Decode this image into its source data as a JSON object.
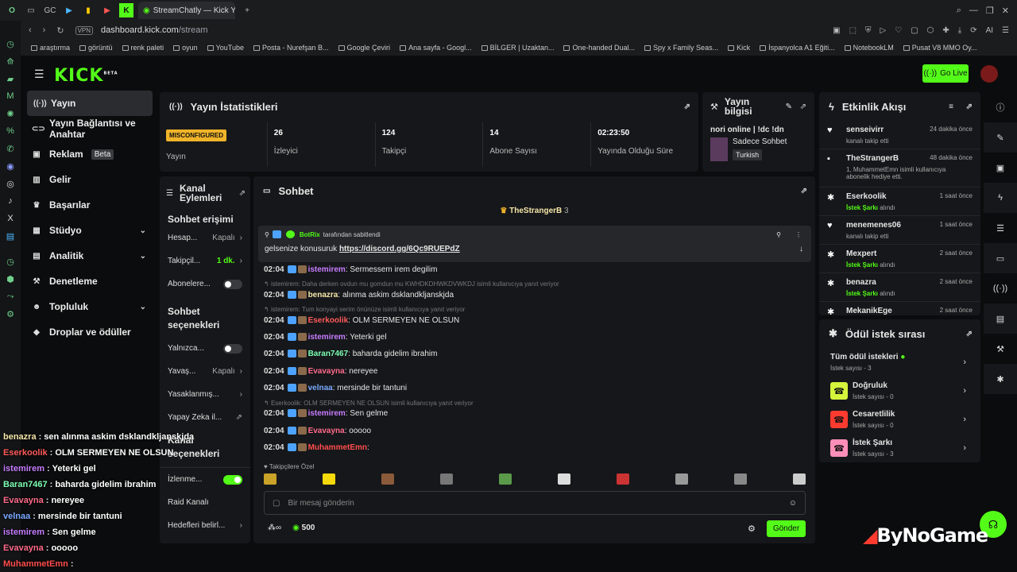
{
  "browser": {
    "tab_title": "StreamChatly — Kick Yayın",
    "url": "dashboard.kick.com/stream",
    "url_domain": "dashboard.kick.com",
    "url_path": "/stream",
    "vpn": "VPN",
    "ai": "AI",
    "bookmarks": [
      "araştırma",
      "görüntü",
      "renk paleti",
      "oyun",
      "YouTube",
      "Posta - Nurefşan B...",
      "Google Çeviri",
      "Ana sayfa - Googl...",
      "BİLGER | Uzaktan...",
      "One-handed Dual...",
      "Spy x Family Seas...",
      "Kick",
      "İspanyolca A1 Eğiti...",
      "NotebookLM",
      "Pusat V8 MMO Oy..."
    ]
  },
  "kick": {
    "logo": "KICK",
    "logo_sup": "BETA",
    "go_live": "Go Live"
  },
  "nav": {
    "items": [
      {
        "label": "Yayın",
        "icon": "((·))"
      },
      {
        "label": "Yayın Bağlantısı ve Anahtar",
        "icon": "⊂⊃"
      },
      {
        "label": "Reklam",
        "icon": "▣",
        "badge": "Beta"
      },
      {
        "label": "Gelir",
        "icon": "▥"
      },
      {
        "label": "Başarılar",
        "icon": "♛"
      },
      {
        "label": "Stüdyo",
        "icon": "▦",
        "chev": "⌄"
      },
      {
        "label": "Analitik",
        "icon": "▤",
        "chev": "⌄"
      },
      {
        "label": "Denetleme",
        "icon": "⚒"
      },
      {
        "label": "Topluluk",
        "icon": "☻",
        "chev": "⌄"
      },
      {
        "label": "Droplar ve ödüller",
        "icon": "◆"
      }
    ]
  },
  "stats": {
    "title": "Yayın İstatistikleri",
    "status_badge": "MISCONFIGURED",
    "status_label": "Yayın",
    "items": [
      {
        "value": "26",
        "label": "İzleyici"
      },
      {
        "value": "124",
        "label": "Takipçi"
      },
      {
        "value": "14",
        "label": "Abone Sayısı"
      },
      {
        "value": "02:23:50",
        "label": "Yayında Olduğu Süre"
      }
    ]
  },
  "info": {
    "title_line1": "Yayın",
    "title_line2": "bilgisi",
    "stream_title": "nori online | !dc !dn",
    "category": "Sadece Sohbet",
    "tag": "Turkish"
  },
  "actions": {
    "title_line1": "Kanal",
    "title_line2": "Eylemleri",
    "sec_chat": "Sohbet erişimi",
    "r1_label": "Hesap...",
    "r1_val": "Kapalı",
    "r2_label": "Takipçil...",
    "r2_val": "1 dk.",
    "r3_label": "Abonelere...",
    "sec_options_1": "Sohbet",
    "sec_options_2": "seçenekleri",
    "r4_label": "Yalnızca...",
    "r5_label": "Yavaş...",
    "r5_val": "Kapalı",
    "r6_label": "Yasaklanmış...",
    "r7_label": "Yapay Zeka il...",
    "sec_channel": "Kanal seçenekleri",
    "r8_label": "İzlenme...",
    "r9_label": "Raid Kanalı",
    "r10_label": "Hedefleri belirl..."
  },
  "chat": {
    "title": "Sohbet",
    "top_gifter": "TheStrangerB",
    "top_gifter_count": "3",
    "pinned_by": "BotRix",
    "pinned_by_suffix": "tarafından sabitlendi",
    "pinned_text": "gelsenize konusuruk",
    "pinned_link": "https://discord.gg/6Qc9RUEPdZ",
    "messages": [
      {
        "time": "02:04",
        "user": "istemirem",
        "text": "Sermessem irem degilim",
        "color": "#c77dff"
      },
      {
        "reply": "istemirem: Daha derken ovdun mu gomdun mu KWHDKDHWKDVWKDJ isimli kullanıcıya yanıt veriyor"
      },
      {
        "time": "02:04",
        "user": "benazra",
        "text": "alınma askim dsklandkljanskjda",
        "color": "#f5e6a8"
      },
      {
        "reply": "istemirem: Tum konyayi serim önünüze isimli kullanıcıya yanıt veriyor"
      },
      {
        "time": "02:04",
        "user": "Eserkoolik",
        "text": "OLM SERMEYEN NE OLSUN",
        "color": "#ff5a5a"
      },
      {
        "time": "02:04",
        "user": "istemirem",
        "text": "Yeterki gel",
        "color": "#c77dff"
      },
      {
        "time": "02:04",
        "user": "Baran7467",
        "text": "baharda gidelim ibrahim",
        "color": "#7dffb3"
      },
      {
        "time": "02:04",
        "user": "Evavayna",
        "text": "nereyee",
        "color": "#ff6b8b"
      },
      {
        "time": "02:04",
        "user": "velnaa",
        "text": "mersinde bir tantuni",
        "color": "#7aa8ff"
      },
      {
        "reply": "Eserkoolik: OLM SERMEYEN NE OLSUN isimli kullanıcıya yanıt veriyor"
      },
      {
        "time": "02:04",
        "user": "istemirem",
        "text": "Sen gelme",
        "color": "#c77dff"
      },
      {
        "time": "02:04",
        "user": "Evavayna",
        "text": "ooooo",
        "color": "#ff6b8b"
      },
      {
        "time": "02:04",
        "user": "MuhammetEmn",
        "text": "",
        "color": "#ff4d4d"
      }
    ],
    "emote_label": "Takipçilere Özel",
    "input_placeholder": "Bir mesaj gönderin",
    "points": "500",
    "send": "Gönder"
  },
  "activity": {
    "title": "Etkinlik Akışı",
    "items": [
      {
        "user": "senseivirr",
        "desc": "kanalı takip etti",
        "time": "24 dakika önce",
        "icon": "♥"
      },
      {
        "user": "TheStrangerB",
        "desc": "1, MuhammetEmn isimli kullanıcıya abonelik hediye etti.",
        "time": "48 dakika önce",
        "icon": "▪"
      },
      {
        "user": "Eserkoolik",
        "desc": "İstek Şarkı alındı",
        "time": "1 saat önce",
        "icon": "✱"
      },
      {
        "user": "menemenes06",
        "desc": "kanalı takip etti",
        "time": "1 saat önce",
        "icon": "♥"
      },
      {
        "user": "Mexpert",
        "desc": "İstek Şarkı alındı",
        "time": "2 saat önce",
        "icon": "✱"
      },
      {
        "user": "benazra",
        "desc": "İstek Şarkı alındı",
        "time": "2 saat önce",
        "icon": "✱"
      },
      {
        "user": "MekanikEge",
        "desc": "",
        "time": "2 saat önce",
        "icon": "✱"
      }
    ]
  },
  "rewards": {
    "title": "Ödül istek sırası",
    "all": "Tüm ödül istekleri",
    "all_count": "İstek sayısı - 3",
    "items": [
      {
        "name": "Doğruluk",
        "count": "İstek sayısı - 0",
        "color": "#d4f53c"
      },
      {
        "name": "Cesaretlilik",
        "count": "İstek sayısı - 0",
        "color": "#ff3b30"
      },
      {
        "name": "İstek Şarkı",
        "count": "İstek sayısı - 3",
        "color": "#ff8fb8"
      }
    ]
  },
  "overlay": [
    {
      "user": "benazra",
      "text": "sen alınma askim dsklandkljanskjda",
      "color": "#f5e6a8"
    },
    {
      "user": "Eserkoolik",
      "text": "OLM SERMEYEN NE OLSUN",
      "color": "#ff5a5a"
    },
    {
      "user": "istemirem",
      "text": "Yeterki gel",
      "color": "#c77dff"
    },
    {
      "user": "Baran7467",
      "text": "baharda gidelim ibrahim",
      "color": "#7dffb3"
    },
    {
      "user": "Evavayna",
      "text": "nereyee",
      "color": "#ff6b8b"
    },
    {
      "user": "velnaa",
      "text": "mersinde bir tantuni",
      "color": "#7aa8ff"
    },
    {
      "user": "istemirem",
      "text": "Sen gelme",
      "color": "#c77dff"
    },
    {
      "user": "Evavayna",
      "text": "ooooo",
      "color": "#ff6b8b"
    },
    {
      "user": "MuhammetEmn",
      "text": "",
      "color": "#ff4d4d"
    }
  ],
  "watermark": "ByNoGame"
}
